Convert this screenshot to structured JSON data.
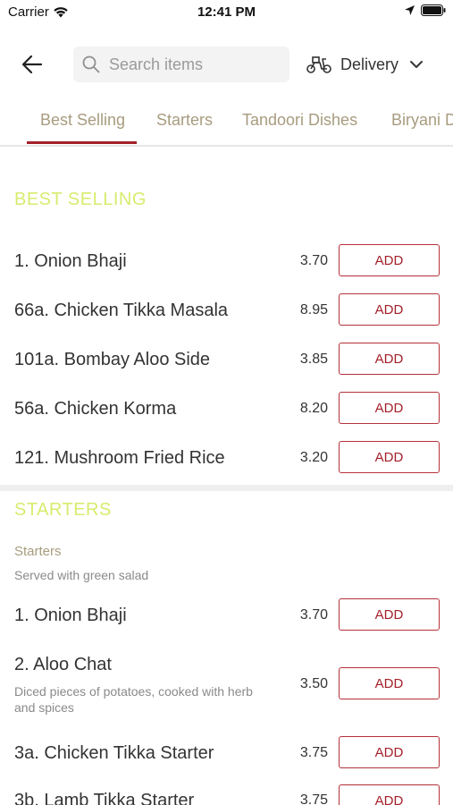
{
  "status_bar": {
    "carrier": "Carrier",
    "time": "12:41 PM"
  },
  "header": {
    "search_placeholder": "Search items",
    "delivery_label": "Delivery"
  },
  "tabs": [
    {
      "label": "Best Selling",
      "active": true
    },
    {
      "label": "Starters",
      "active": false
    },
    {
      "label": "Tandoori Dishes",
      "active": false
    },
    {
      "label": "Biryani Dishes",
      "active": false
    }
  ],
  "best_selling": {
    "title": "BEST SELLING",
    "items": [
      {
        "name": "1. Onion Bhaji",
        "price": "3.70",
        "add_label": "ADD"
      },
      {
        "name": "66a. Chicken Tikka Masala",
        "price": "8.95",
        "add_label": "ADD"
      },
      {
        "name": "101a. Bombay Aloo Side",
        "price": "3.85",
        "add_label": "ADD"
      },
      {
        "name": "56a. Chicken Korma",
        "price": "8.20",
        "add_label": "ADD"
      },
      {
        "name": "121. Mushroom Fried Rice",
        "price": "3.20",
        "add_label": "ADD"
      }
    ]
  },
  "starters": {
    "title": "STARTERS",
    "subheading": "Starters",
    "note": "Served with green salad",
    "items": [
      {
        "name": "1. Onion Bhaji",
        "description": "",
        "price": "3.70",
        "add_label": "ADD"
      },
      {
        "name": "2. Aloo Chat",
        "description": "Diced pieces of potatoes, cooked with herb and spices",
        "price": "3.50",
        "add_label": "ADD"
      },
      {
        "name": "3a. Chicken Tikka Starter",
        "description": "",
        "price": "3.75",
        "add_label": "ADD"
      },
      {
        "name": "3b. Lamb Tikka Starter",
        "description": "",
        "price": "3.75",
        "add_label": "ADD"
      }
    ]
  },
  "colors": {
    "accent": "#a3202a",
    "section_title": "#d7ec6f",
    "tab_text": "#a89c7f"
  },
  "icons": {
    "back": "arrow-left-icon",
    "search": "search-icon",
    "delivery": "scooter-icon",
    "dropdown": "chevron-down-icon"
  }
}
